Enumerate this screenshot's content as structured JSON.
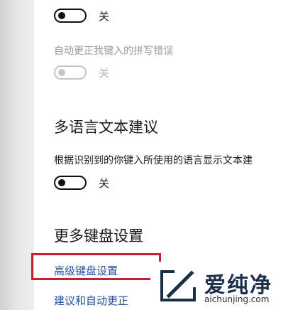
{
  "settings": {
    "toggle1": {
      "state_label": "关",
      "on": false,
      "disabled": false
    },
    "autocorrect_label": "自动更正我键入的拼写错误",
    "toggle2": {
      "state_label": "关",
      "on": false,
      "disabled": true
    },
    "multilang_heading": "多语言文本建议",
    "multilang_desc": "根据识别到的你键入所使用的语言显示文本建",
    "toggle3": {
      "state_label": "关",
      "on": false,
      "disabled": false
    },
    "more_keyboard_heading": "更多键盘设置",
    "advanced_keyboard_link": "高级键盘设置",
    "suggestions_link": "建议和自动更正"
  },
  "highlight_color": "#c8202e",
  "watermark": {
    "title": "爱纯净",
    "domain": "aichunjing.com",
    "logo_icon": "slash-square-logo"
  }
}
